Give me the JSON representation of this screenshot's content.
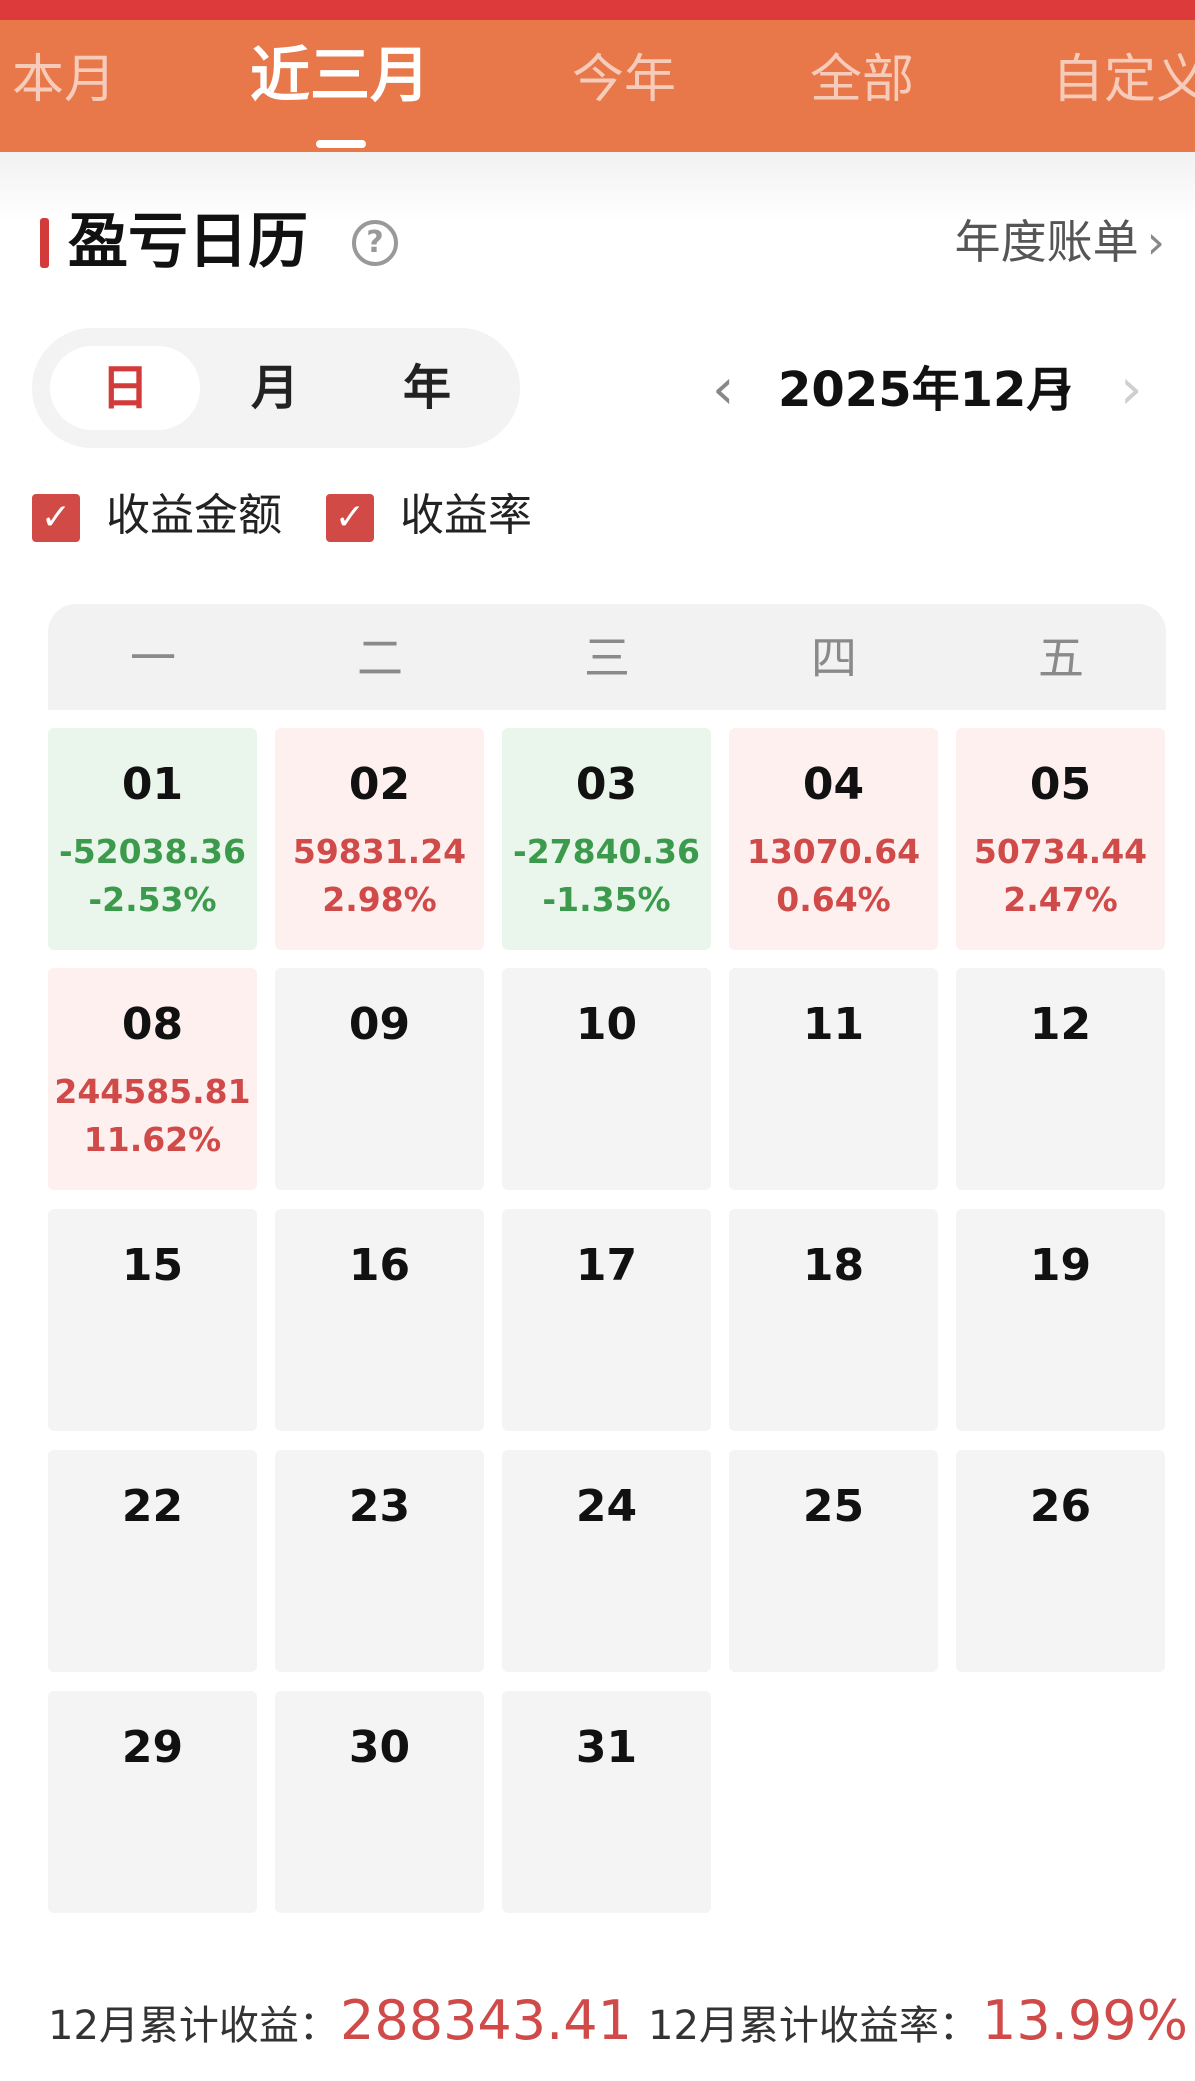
{
  "tabs": [
    "本月",
    "近三月",
    "今年",
    "全部",
    "自定义"
  ],
  "active_tab": "近三月",
  "section": {
    "title": "盈亏日历",
    "help_icon": "question-circle-icon",
    "annual_link": "年度账单",
    "annual_chevron": "›"
  },
  "view_modes": [
    "日",
    "月",
    "年"
  ],
  "active_view_mode": "日",
  "month_nav": {
    "prev": "‹",
    "label": "2025年12月",
    "caret": "▾",
    "next": "›"
  },
  "filters": [
    {
      "label": "收益金额",
      "checked": true
    },
    {
      "label": "收益率",
      "checked": true
    }
  ],
  "weekdays": [
    "一",
    "二",
    "三",
    "四",
    "五"
  ],
  "days": [
    {
      "day": "01",
      "amount": "-52038.36",
      "rate": "-2.53%",
      "status": "loss"
    },
    {
      "day": "02",
      "amount": "59831.24",
      "rate": "2.98%",
      "status": "gain"
    },
    {
      "day": "03",
      "amount": "-27840.36",
      "rate": "-1.35%",
      "status": "loss"
    },
    {
      "day": "04",
      "amount": "13070.64",
      "rate": "0.64%",
      "status": "gain"
    },
    {
      "day": "05",
      "amount": "50734.44",
      "rate": "2.47%",
      "status": "gain"
    },
    {
      "day": "08",
      "amount": "244585.81",
      "rate": "11.62%",
      "status": "gain"
    },
    {
      "day": "09",
      "amount": "",
      "rate": "",
      "status": "none"
    },
    {
      "day": "10",
      "amount": "",
      "rate": "",
      "status": "none"
    },
    {
      "day": "11",
      "amount": "",
      "rate": "",
      "status": "none"
    },
    {
      "day": "12",
      "amount": "",
      "rate": "",
      "status": "none"
    },
    {
      "day": "15",
      "amount": "",
      "rate": "",
      "status": "none"
    },
    {
      "day": "16",
      "amount": "",
      "rate": "",
      "status": "none"
    },
    {
      "day": "17",
      "amount": "",
      "rate": "",
      "status": "none"
    },
    {
      "day": "18",
      "amount": "",
      "rate": "",
      "status": "none"
    },
    {
      "day": "19",
      "amount": "",
      "rate": "",
      "status": "none"
    },
    {
      "day": "22",
      "amount": "",
      "rate": "",
      "status": "none"
    },
    {
      "day": "23",
      "amount": "",
      "rate": "",
      "status": "none"
    },
    {
      "day": "24",
      "amount": "",
      "rate": "",
      "status": "none"
    },
    {
      "day": "25",
      "amount": "",
      "rate": "",
      "status": "none"
    },
    {
      "day": "26",
      "amount": "",
      "rate": "",
      "status": "none"
    },
    {
      "day": "29",
      "amount": "",
      "rate": "",
      "status": "none"
    },
    {
      "day": "30",
      "amount": "",
      "rate": "",
      "status": "none"
    },
    {
      "day": "31",
      "amount": "",
      "rate": "",
      "status": "none"
    }
  ],
  "summary": {
    "income_label": "12月累计收益：",
    "income_value": "288343.41",
    "rate_label": "12月累计收益率：",
    "rate_value": "13.99%"
  },
  "colors": {
    "accent_orange": "#e8784a",
    "top_red": "#dd3b3b",
    "gain_red": "#cf4a48",
    "loss_green": "#3c9a4c",
    "gain_bg": "#fdf0ef",
    "loss_bg": "#eaf6ec"
  }
}
